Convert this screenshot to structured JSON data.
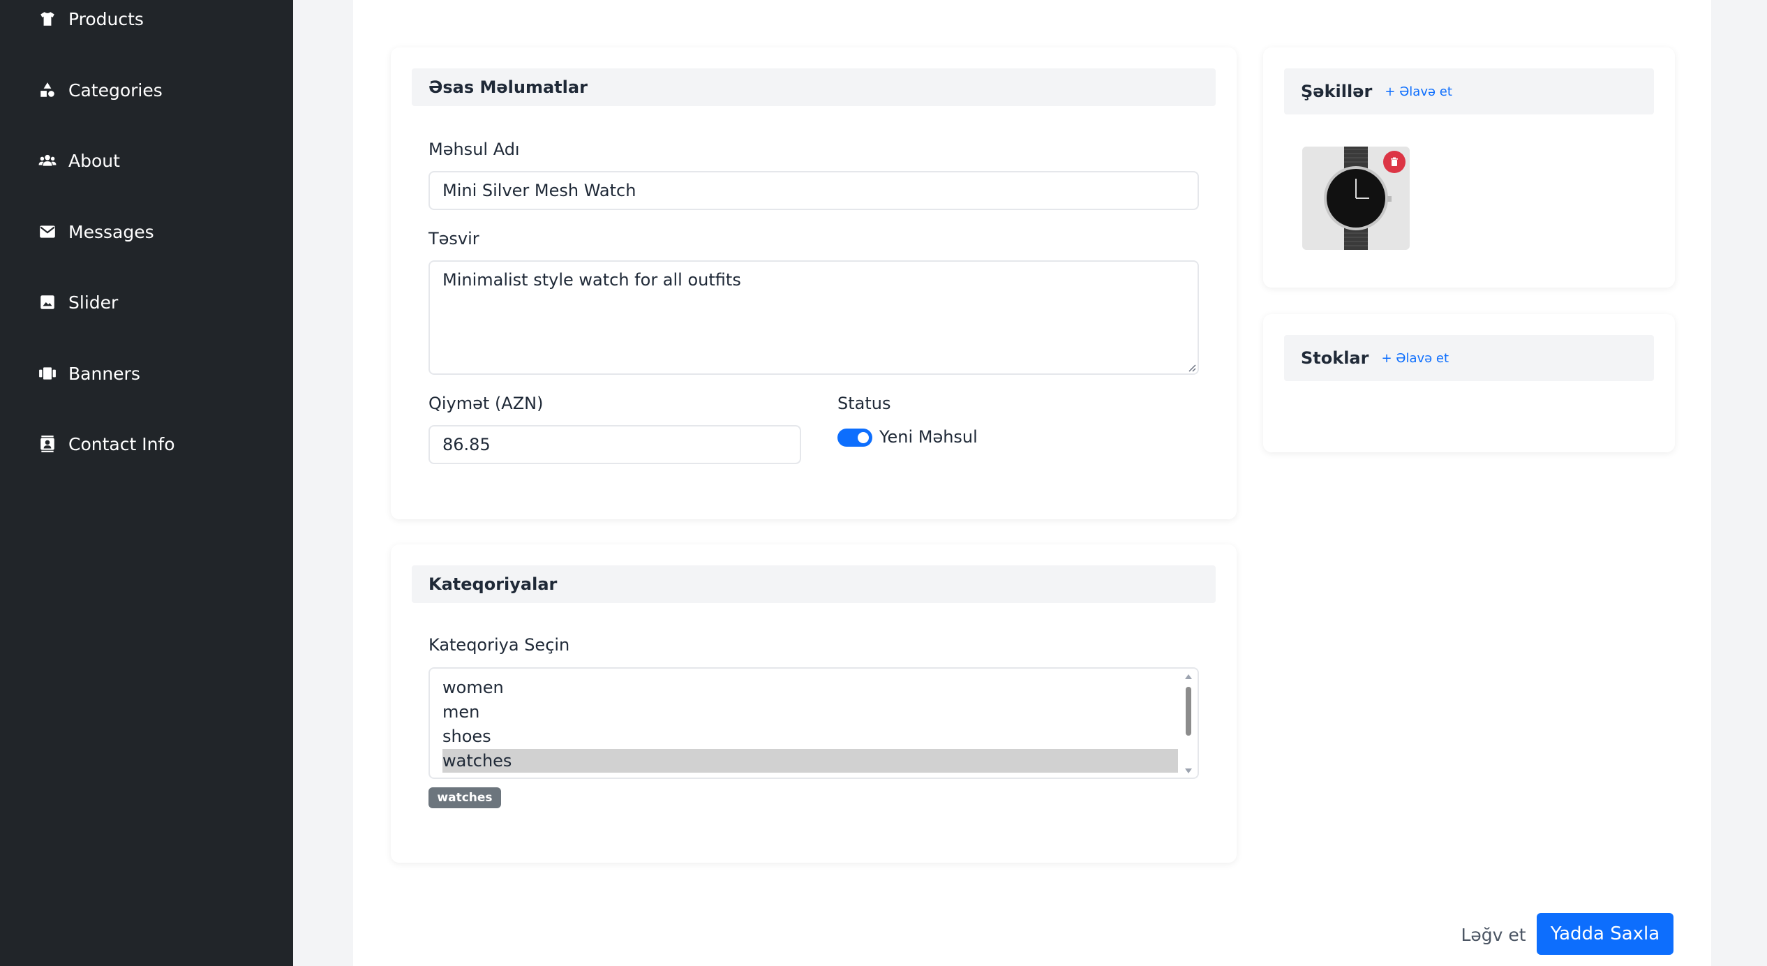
{
  "sidebar": {
    "items": [
      {
        "label": "Products",
        "icon": "shirt-icon"
      },
      {
        "label": "Categories",
        "icon": "shapes-icon"
      },
      {
        "label": "About",
        "icon": "users-icon"
      },
      {
        "label": "Messages",
        "icon": "envelope-icon"
      },
      {
        "label": "Slider",
        "icon": "image-icon"
      },
      {
        "label": "Banners",
        "icon": "panels-icon"
      },
      {
        "label": "Contact Info",
        "icon": "contact-card-icon"
      }
    ]
  },
  "basic_info": {
    "title": "Əsas Məlumatlar",
    "name_label": "Məhsul Adı",
    "name_value": "Mini Silver Mesh Watch",
    "desc_label": "Təsvir",
    "desc_value": "Minimalist style watch for all outfits",
    "price_label": "Qiymət (AZN)",
    "price_value": "86.85",
    "status_label": "Status",
    "status_option": "Yeni Məhsul",
    "status_on": true
  },
  "categories": {
    "title": "Kateqoriyalar",
    "select_label": "Kateqoriya Seçin",
    "options": [
      "women",
      "men",
      "shoes",
      "watches"
    ],
    "selected": "watches",
    "selected_tags": [
      "watches"
    ]
  },
  "images": {
    "title": "Şəkillər",
    "add_label": "+ Əlavə et",
    "thumb_icon": "watch-image"
  },
  "stocks": {
    "title": "Stoklar",
    "add_label": "+ Əlavə et"
  },
  "actions": {
    "cancel_label": "Ləğv et",
    "save_label": "Yadda Saxla"
  },
  "colors": {
    "sidebar_bg": "#212529",
    "accent": "#0d6efd",
    "danger": "#dc3545",
    "chip": "#6c757d"
  }
}
